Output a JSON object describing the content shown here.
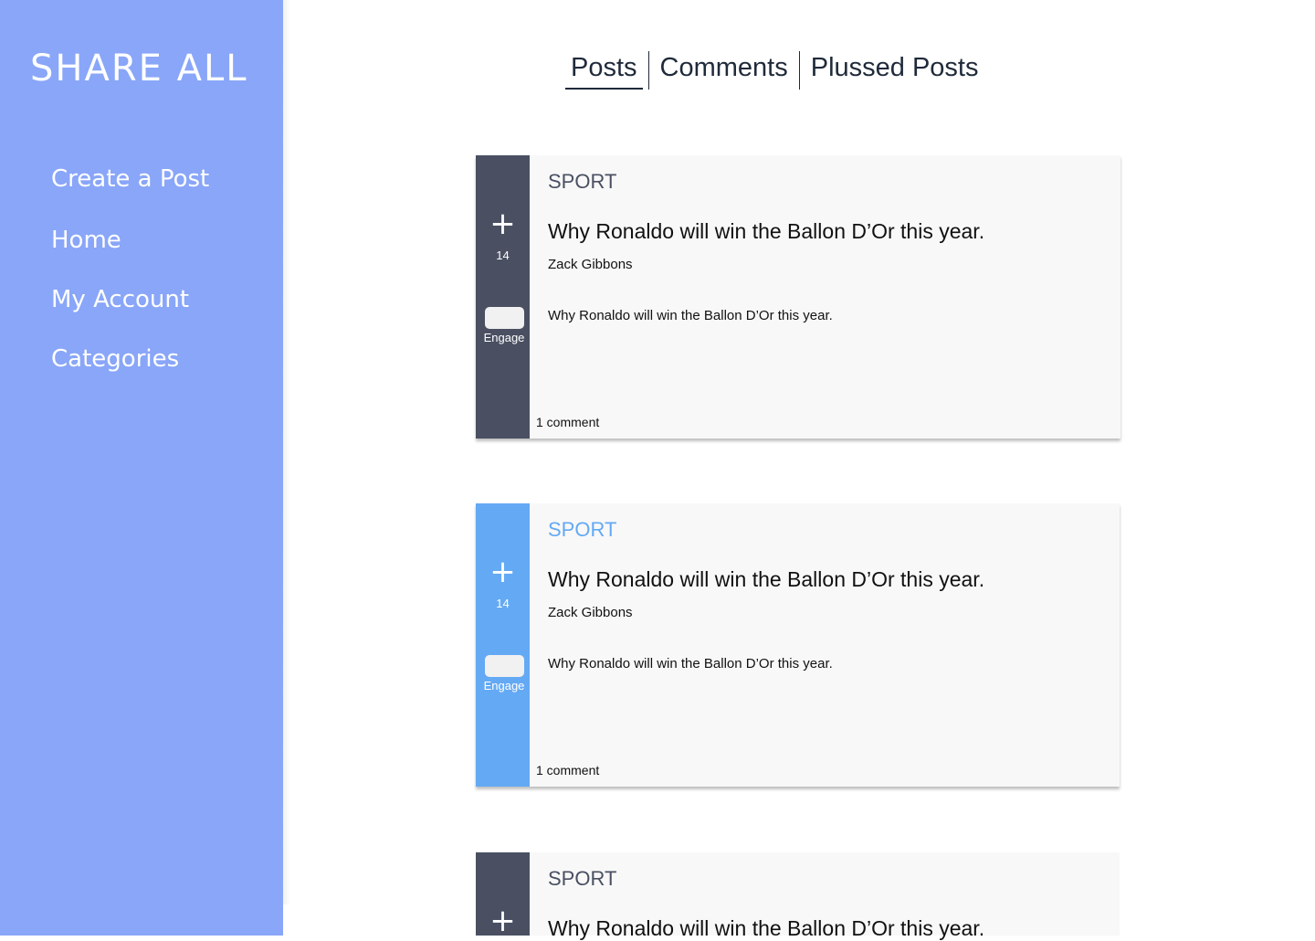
{
  "app": {
    "brand": "SHARE ALL"
  },
  "sidebar": {
    "items": [
      {
        "label": "Create a Post"
      },
      {
        "label": "Home"
      },
      {
        "label": "My Account"
      },
      {
        "label": "Categories"
      }
    ]
  },
  "tabs": {
    "items": [
      {
        "label": "Posts",
        "active": true
      },
      {
        "label": "Comments",
        "active": false
      },
      {
        "label": "Plussed Posts",
        "active": false
      }
    ]
  },
  "posts": [
    {
      "category": "SPORT",
      "title": "Why Ronaldo will win the Ballon D’Or this year.",
      "author": "Zack Gibbons",
      "excerpt": "Why Ronaldo will win the Ballon D’Or this year.",
      "plus_count": "14",
      "plus_symbol": "+",
      "engage_label": "Engage",
      "comments": "1 comment",
      "highlighted": false
    },
    {
      "category": "SPORT",
      "title": "Why Ronaldo will win the Ballon D’Or this year.",
      "author": "Zack Gibbons",
      "excerpt": "Why Ronaldo will win the Ballon D’Or this year.",
      "plus_count": "14",
      "plus_symbol": "+",
      "engage_label": "Engage",
      "comments": "1 comment",
      "highlighted": true
    },
    {
      "category": "SPORT",
      "title": "Why Ronaldo will win the Ballon D’Or this year.",
      "plus_symbol": "+",
      "highlighted": false
    }
  ],
  "colors": {
    "sidebar": "#89a6f8",
    "rail_default": "#4a5062",
    "rail_highlight": "#64a9f4"
  }
}
